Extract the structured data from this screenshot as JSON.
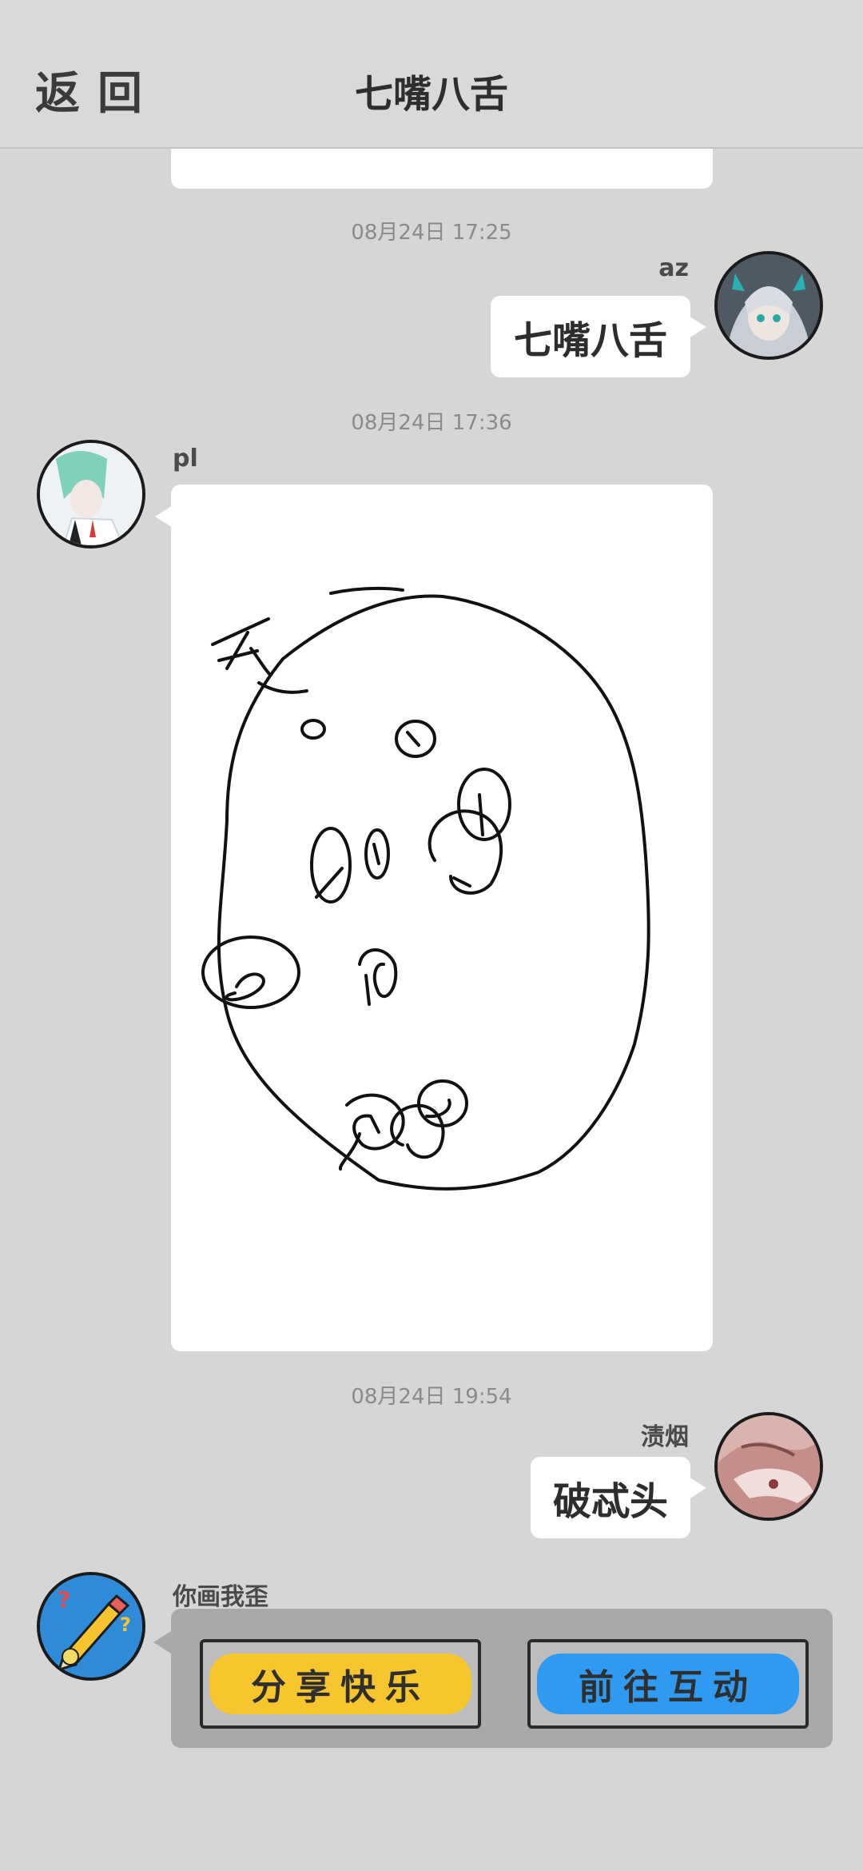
{
  "header": {
    "back_label": "返回",
    "title": "七嘴八舌"
  },
  "messages": [
    {
      "timestamp": "08月24日  17:25",
      "sender": "az",
      "text": "七嘴八舌"
    },
    {
      "timestamp": "08月24日  17:36",
      "sender": "pl",
      "content": "drawing"
    },
    {
      "timestamp": "08月24日  19:54",
      "sender": "渍烟",
      "text": "破忒头"
    },
    {
      "sender": "你画我歪",
      "buttons": [
        "分享快乐",
        "前往互动"
      ]
    }
  ],
  "colors": {
    "background": "#d6d6d6",
    "share_button": "#f7c62f",
    "interact_button": "#2f9af0"
  }
}
